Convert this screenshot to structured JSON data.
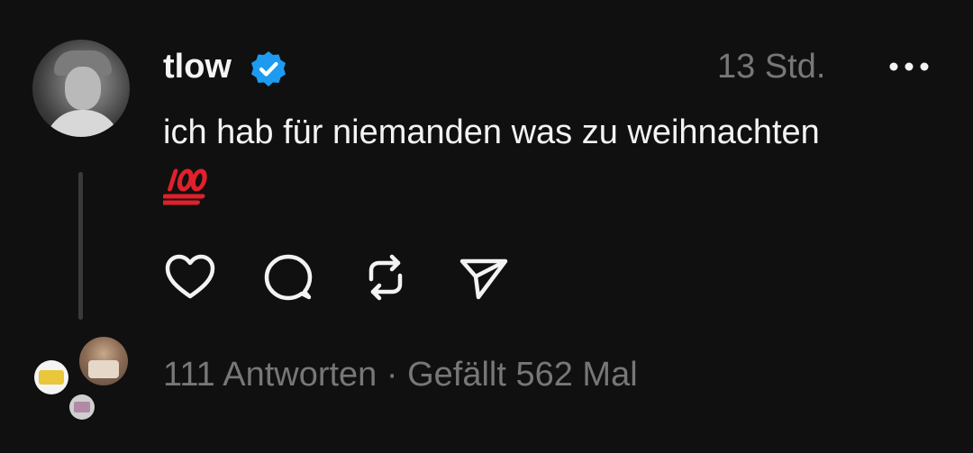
{
  "post": {
    "username": "tlow",
    "timestamp": "13 Std.",
    "text": "ich hab für niemanden was zu weihnachten",
    "emoji_icon": "hundred-points-emoji",
    "stats": "111 Antworten · Gefällt 562 Mal"
  },
  "colors": {
    "background": "#101010",
    "text": "#f3f3f3",
    "muted": "#777777",
    "verified": "#1d9bf0",
    "emoji_red": "#e0202a"
  },
  "actions": {
    "like_icon": "heart-icon",
    "reply_icon": "comment-icon",
    "repost_icon": "repost-icon",
    "share_icon": "send-icon"
  }
}
